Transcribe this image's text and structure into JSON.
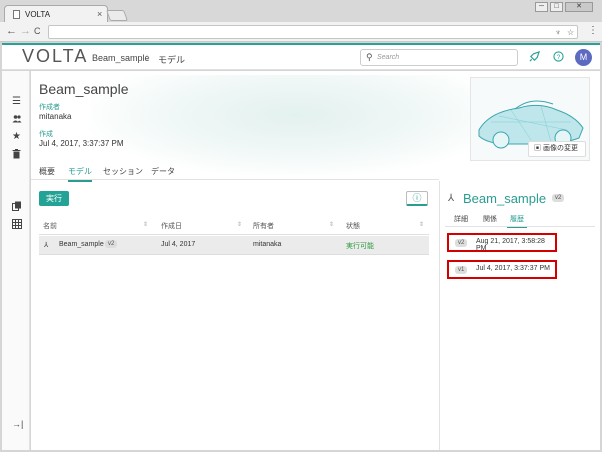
{
  "browser": {
    "tab_title": "VOLTA",
    "tab_close": "×",
    "window_buttons": [
      "─",
      "□",
      "✕"
    ],
    "nav_icons": {
      "back": "←",
      "forward": "→",
      "reload": "C"
    },
    "menu": "⋮"
  },
  "header": {
    "logo": "VOLTA",
    "breadcrumb": {
      "project": "Beam_sample",
      "separator": "›",
      "page": "モデル"
    },
    "search_placeholder": "Search",
    "avatar_initial": "M",
    "icons": [
      "rocket-icon",
      "help-icon"
    ]
  },
  "sidebar": {
    "icons": [
      "list-icon",
      "users-icon",
      "star-icon",
      "trash-icon",
      "copy-icon",
      "grid-icon",
      "exit-icon"
    ]
  },
  "project": {
    "title": "Beam_sample",
    "author_label": "作成者",
    "author": "mitanaka",
    "created_label": "作成",
    "created": "Jul 4, 2017, 3:37:37 PM",
    "image_change": "画像の変更"
  },
  "tabs": [
    "概要",
    "モデル",
    "セッション",
    "データ"
  ],
  "active_tab": "モデル",
  "toolbar": {
    "run_label": "実行",
    "info_icon": "ⓘ"
  },
  "table": {
    "headers": [
      "名前",
      "作成日",
      "所有者",
      "状態"
    ],
    "rows": [
      {
        "name": "Beam_sample",
        "version": "v2",
        "created": "Jul 4, 2017",
        "owner": "mitanaka",
        "status": "実行可能"
      }
    ]
  },
  "right_panel": {
    "title": "Beam_sample",
    "version": "v2",
    "tabs": [
      "詳細",
      "関係",
      "履歴"
    ],
    "active_tab": "履歴",
    "history": [
      {
        "version": "v2",
        "date": "Aug 21, 2017, 3:58:28 PM"
      },
      {
        "version": "v1",
        "date": "Jul 4, 2017, 3:37:37 PM"
      }
    ]
  },
  "colors": {
    "accent": "#2aa198",
    "highlight_border": "#d40000",
    "status_ok": "#2e9a3f"
  }
}
